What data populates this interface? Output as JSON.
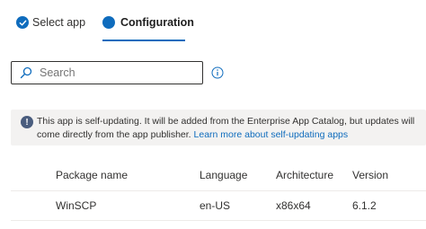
{
  "wizard": {
    "steps": [
      {
        "label": "Select app",
        "state": "completed",
        "icon": "checkmark-icon"
      },
      {
        "label": "Configuration",
        "state": "current",
        "icon": "filled-circle-icon"
      }
    ]
  },
  "search": {
    "placeholder": "Search",
    "value": ""
  },
  "banner": {
    "text": "This app is self-updating. It will be added from the Enterprise App Catalog, but updates will come directly from the app publisher.",
    "link_text": "Learn more about self-updating apps"
  },
  "table": {
    "columns": [
      "Package name",
      "Language",
      "Architecture",
      "Version"
    ],
    "rows": [
      [
        "WinSCP",
        "en-US",
        "x86x64",
        "6.1.2"
      ]
    ]
  },
  "colors": {
    "accent": "#0f6cbd",
    "banner_bg": "#f3f2f1",
    "info_icon": "#4a5d7e"
  }
}
